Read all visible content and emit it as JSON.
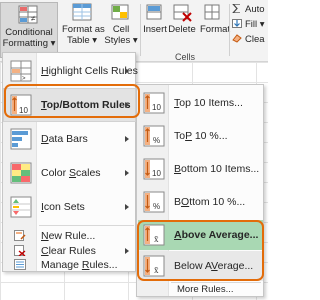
{
  "ribbon": {
    "conditional_formatting": {
      "line1": "Conditional",
      "line2": "Formatting ▾"
    },
    "format_as_table": {
      "line1": "Format as",
      "line2": "Table ▾"
    },
    "cell_styles": {
      "line1": "Cell",
      "line2": "Styles ▾"
    },
    "insert": {
      "label": "Insert"
    },
    "delete": {
      "label": "Delete"
    },
    "format": {
      "label": "Format"
    },
    "group_cells": "Cells",
    "right_items": [
      "Auto",
      "Fill ▾",
      "Clea"
    ]
  },
  "main_menu": {
    "items": [
      {
        "label": "Highlight Cells Rules",
        "underline": "H",
        "has_submenu": true
      },
      {
        "label": "Top/Bottom Rules",
        "underline": "T",
        "has_submenu": true,
        "highlighted": true
      },
      {
        "label": "Data Bars",
        "underline": "D",
        "has_submenu": true
      },
      {
        "label": "Color Scales",
        "underline": "S",
        "has_submenu": true
      },
      {
        "label": "Icon Sets",
        "underline": "I",
        "has_submenu": true
      }
    ],
    "actions": [
      {
        "label": "New Rule...",
        "underline": "N"
      },
      {
        "label": "Clear Rules",
        "underline": "C",
        "has_submenu": true
      },
      {
        "label": "Manage Rules...",
        "underline": "R"
      }
    ]
  },
  "sub_menu": {
    "items": [
      {
        "label": "Top 10 Items...",
        "underline": "T",
        "icon_text": "10"
      },
      {
        "label": "Top 10 %...",
        "underline": "P",
        "icon_text": "%"
      },
      {
        "label": "Bottom 10 Items...",
        "underline": "B",
        "icon_text": "10"
      },
      {
        "label": "Bottom 10 %...",
        "underline": "O",
        "icon_text": "%"
      },
      {
        "label": "Above Average...",
        "underline": "A",
        "icon_text": "x̄",
        "highlighted": true
      },
      {
        "label": "Below Average...",
        "underline": "V",
        "icon_text": "x̄"
      }
    ],
    "more_rules": "More Rules..."
  },
  "colors": {
    "highlight_orange": "#e36c09",
    "hover_green": "#a9d8b3",
    "ribbon_bg": "#f3f3f3",
    "menu_bg": "#fcfcfc"
  }
}
